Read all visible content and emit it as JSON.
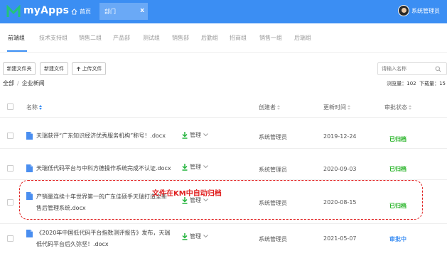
{
  "header": {
    "app_name": "myApps",
    "home_label": "首页",
    "open_tab": "部门",
    "close_glyph": "x",
    "user_name": "系统管理员",
    "accent_color": "#3b8ef3"
  },
  "sub_tabs": [
    "前端组",
    "技术支持组",
    "销售二组",
    "产品部",
    "测试组",
    "销售部",
    "后勤组",
    "招商组",
    "销售一组",
    "后端组"
  ],
  "active_sub_tab": "前端组",
  "toolbar": {
    "new_folder": "新建文件夹",
    "new_file": "新建文件",
    "upload": "上传文件",
    "search_placeholder": "请输入名称"
  },
  "breadcrumb": [
    "全部",
    "企业新闻"
  ],
  "breadcrumb_sep": "/",
  "stats": {
    "views_label": "浏览量：",
    "views": "102",
    "downloads_label": "下载量：",
    "downloads": "15"
  },
  "table": {
    "columns": {
      "name": "名称",
      "creator": "创建者",
      "updated": "更新时间",
      "status": "审批状态"
    },
    "manage_label": "管理",
    "rows": [
      {
        "name_lines": [
          "天瑞获评“广东知识经济优秀服务机构”称号！.docx"
        ],
        "creator": "系统管理员",
        "date": "2019-12-24",
        "status": "已归档",
        "status_color": "#21b121"
      },
      {
        "name_lines": [
          "天瑞低代码平台与中科方德操作系统完成不认证.docx"
        ],
        "creator": "系统管理员",
        "date": "2020-09-03",
        "status": "已归档",
        "status_color": "#21b121"
      },
      {
        "name_lines": [
          "产销量连续十年世界第一的广东佳硕手天瑞打造全新",
          "售后管理系统.docx"
        ],
        "creator": "系统管理员",
        "date": "2020-08-15",
        "status": "已归档",
        "status_color": "#21b121"
      },
      {
        "name_lines": [
          "《2020年中国低代码平台指数测评报告》发布，天瑞",
          "低代码平台后久弥坚！.docx"
        ],
        "creator": "系统管理员",
        "date": "2021-05-07",
        "status": "审批中",
        "status_color": "#3b8ef3"
      }
    ]
  },
  "annotation": {
    "text": "文件在KM中自动归档",
    "color": "#e02020"
  }
}
